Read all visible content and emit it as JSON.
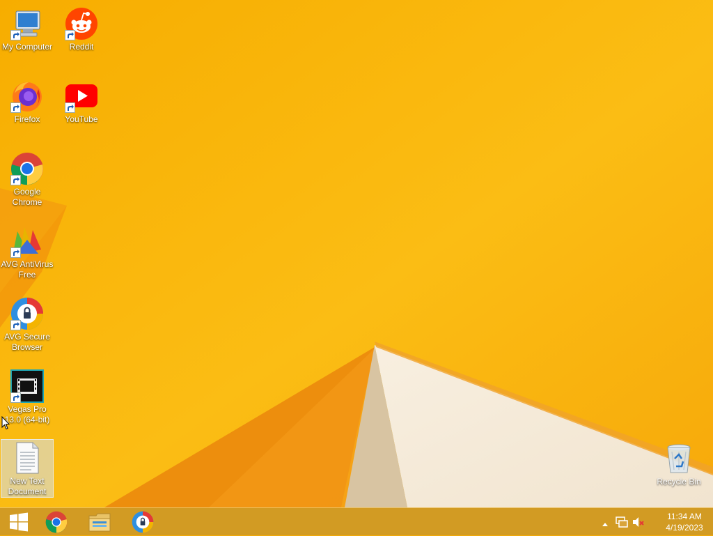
{
  "desktop": {
    "icons": [
      {
        "label": "My Computer",
        "icon": "computer-icon"
      },
      {
        "label": "Reddit",
        "icon": "reddit-icon"
      },
      {
        "label": "Firefox",
        "icon": "firefox-icon"
      },
      {
        "label": "YouTube",
        "icon": "youtube-icon"
      },
      {
        "label": "Google Chrome",
        "icon": "chrome-icon"
      },
      {
        "label": "AVG AntiVirus Free",
        "icon": "avg-antivirus-icon"
      },
      {
        "label": "AVG Secure Browser",
        "icon": "avg-browser-icon"
      },
      {
        "label": "Vegas Pro 13.0 (64-bit)",
        "icon": "vegas-pro-icon"
      },
      {
        "label": "New Text Document",
        "icon": "text-document-icon"
      },
      {
        "label": "Recycle Bin",
        "icon": "recycle-bin-icon"
      }
    ]
  },
  "taskbar": {
    "items": [
      {
        "name": "start-button",
        "icon": "windows-logo-icon"
      },
      {
        "name": "taskbar-chrome",
        "icon": "chrome-icon"
      },
      {
        "name": "taskbar-file-explorer",
        "icon": "folder-icon"
      },
      {
        "name": "taskbar-avg-browser",
        "icon": "avg-browser-icon"
      }
    ],
    "tray": {
      "icons": [
        "chevron-up-icon",
        "network-icon",
        "volume-muted-icon"
      ],
      "time": "11:34 AM",
      "date": "4/19/2023"
    }
  },
  "colors": {
    "wallpaper": "#f5ab05",
    "wallpaper_light": "#fdc21a",
    "taskbar": "#ce9926"
  }
}
